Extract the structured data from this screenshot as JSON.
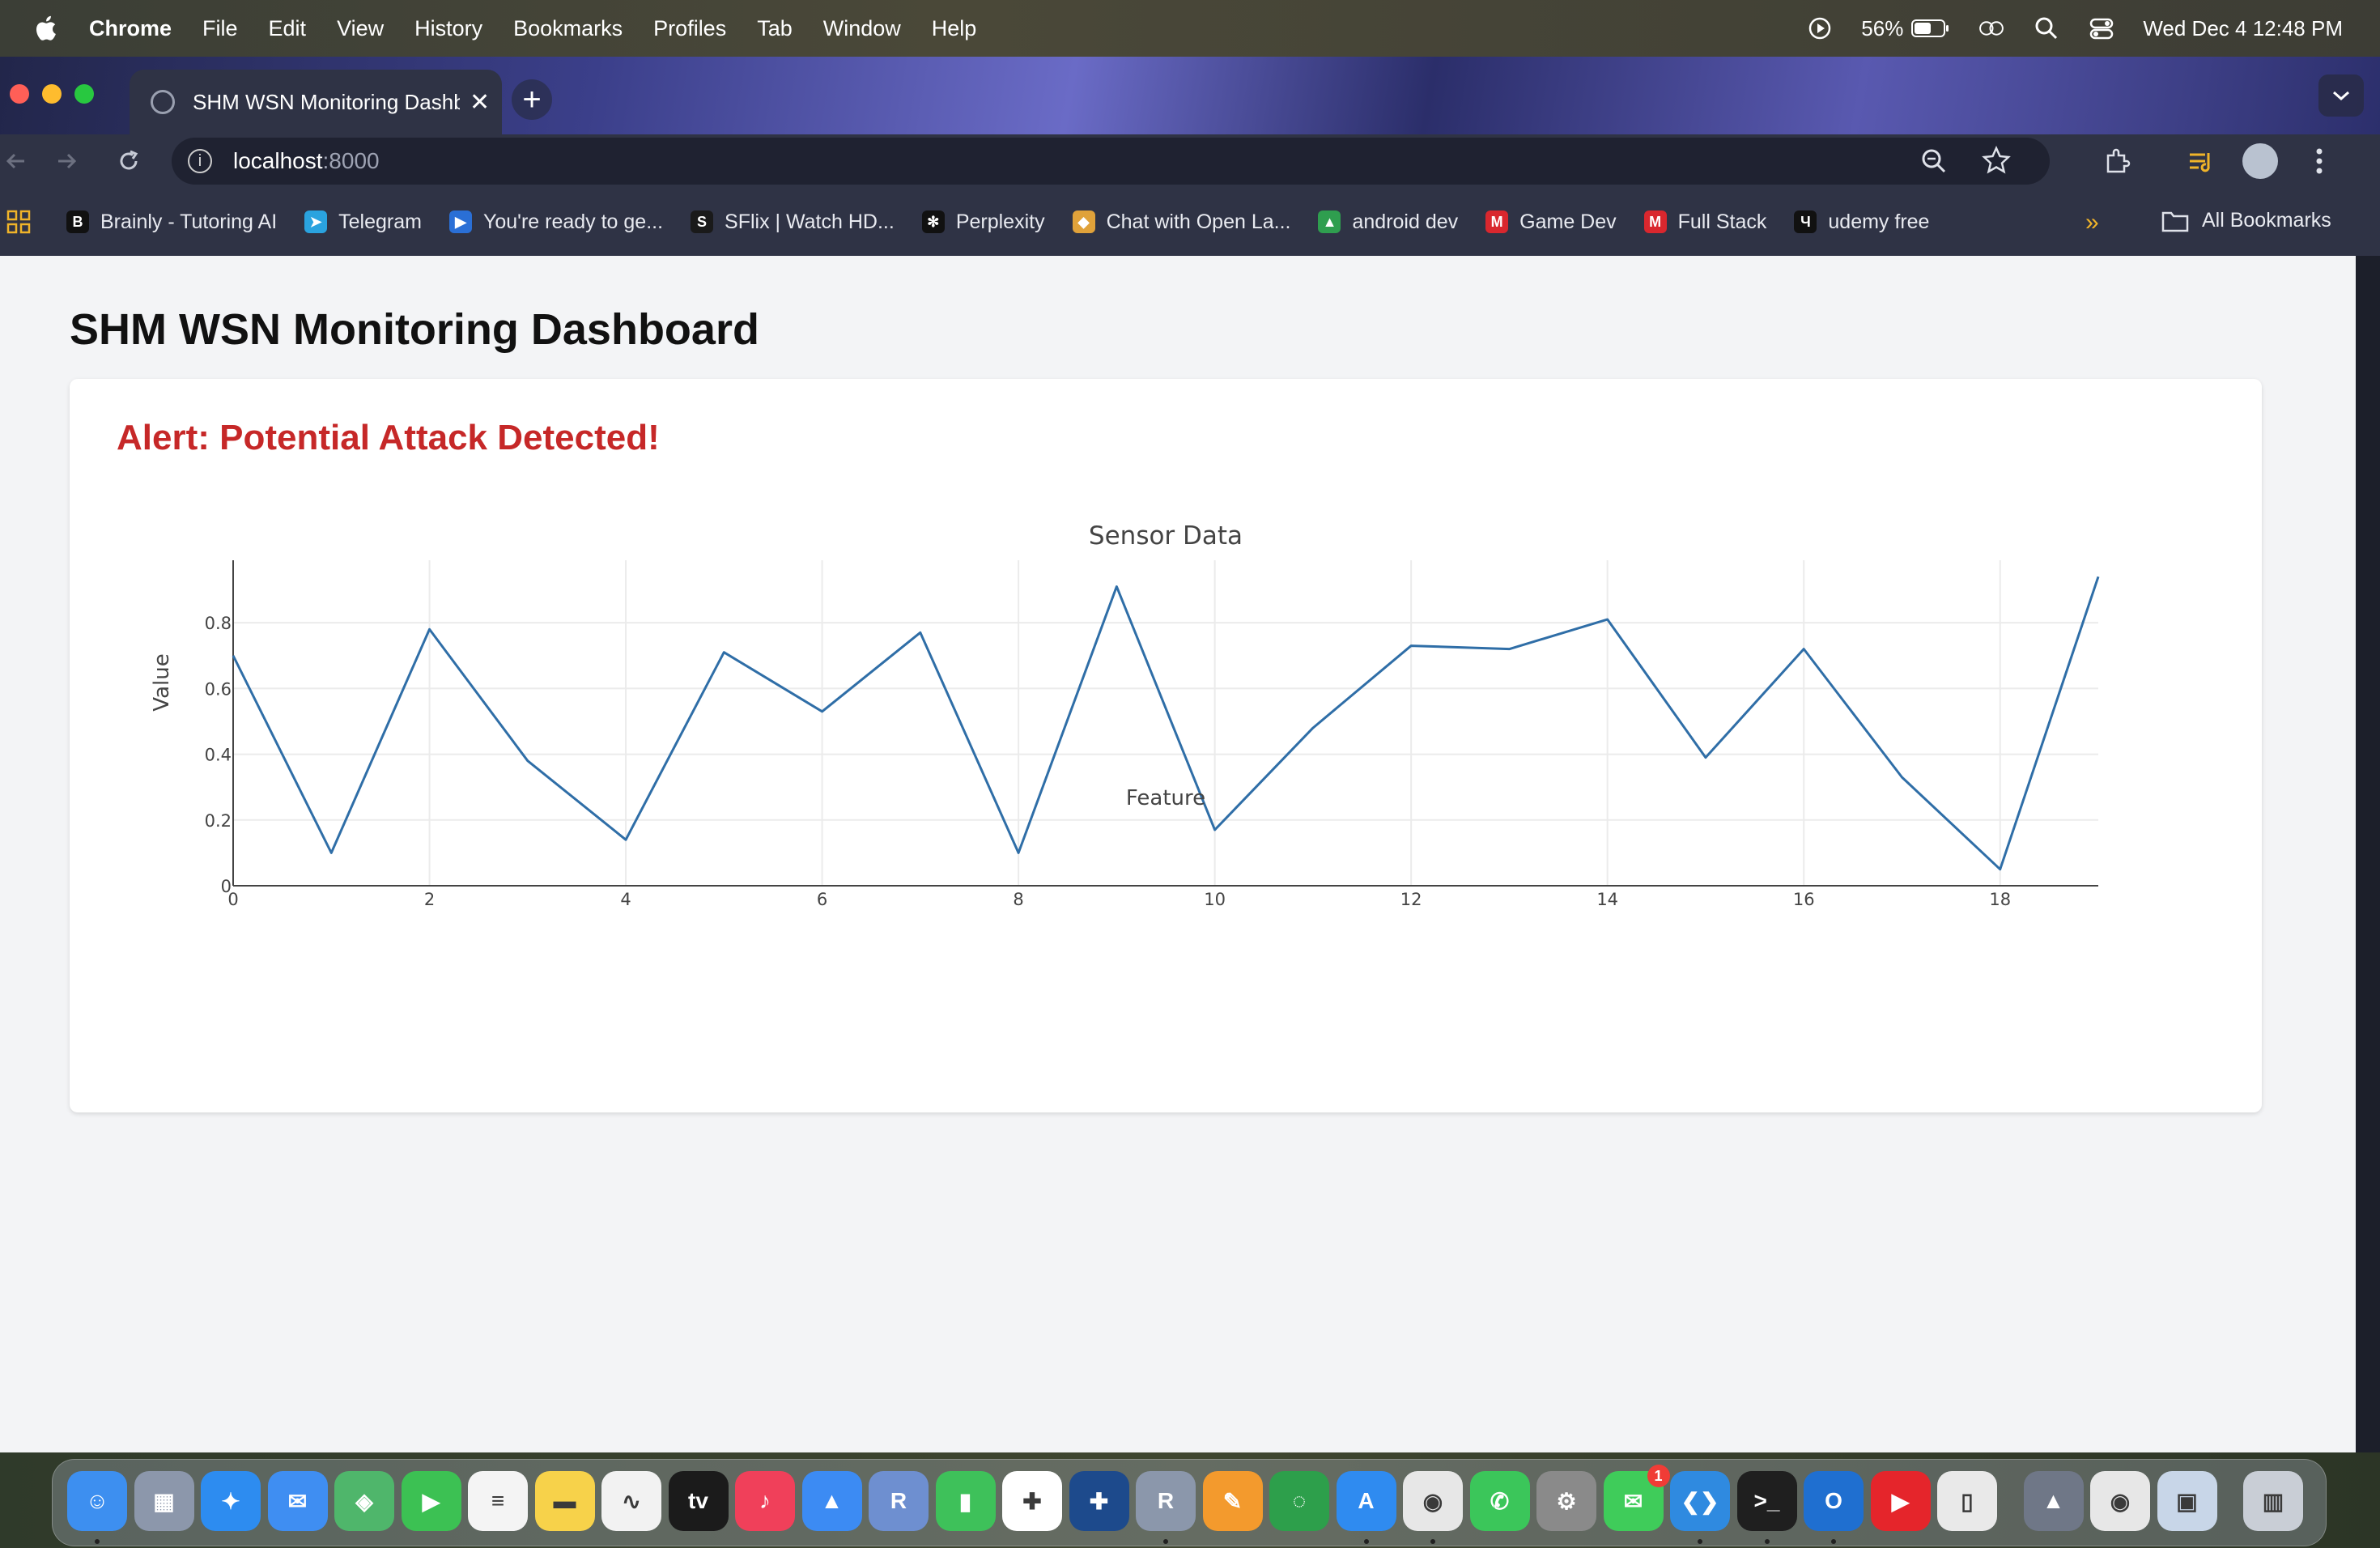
{
  "menubar": {
    "app_name": "Chrome",
    "items": [
      "File",
      "Edit",
      "View",
      "History",
      "Bookmarks",
      "Profiles",
      "Tab",
      "Window",
      "Help"
    ],
    "battery": "56%",
    "datetime": "Wed Dec 4  12:48 PM"
  },
  "browser": {
    "tab_title": "SHM WSN Monitoring Dashboard",
    "url_host": "localhost",
    "url_port": ":8000",
    "bookmarks": [
      {
        "label": "Brainly - Tutoring AI",
        "icon": "brainly-icon",
        "color": "#111111",
        "glyph": "B"
      },
      {
        "label": "Telegram",
        "icon": "telegram-icon",
        "color": "#2aa3df",
        "glyph": "➤"
      },
      {
        "label": "You're ready to ge...",
        "icon": "play-icon",
        "color": "#2a6fd6",
        "glyph": "▶"
      },
      {
        "label": "SFlix | Watch HD...",
        "icon": "sflix-icon",
        "color": "#1a1a1a",
        "glyph": "S"
      },
      {
        "label": "Perplexity",
        "icon": "perplexity-icon",
        "color": "#111111",
        "glyph": "✻"
      },
      {
        "label": "Chat with Open La...",
        "icon": "layers-icon",
        "color": "#e0a23a",
        "glyph": "◆"
      },
      {
        "label": "android dev",
        "icon": "drive-icon",
        "color": "#2f9e4f",
        "glyph": "▲"
      },
      {
        "label": "Game Dev",
        "icon": "mega-icon",
        "color": "#d9272e",
        "glyph": "M"
      },
      {
        "label": "Full Stack",
        "icon": "mega-icon",
        "color": "#d9272e",
        "glyph": "M"
      },
      {
        "label": "udemy free",
        "icon": "udemy-icon",
        "color": "#111111",
        "glyph": "Ч"
      }
    ],
    "all_bookmarks": "All Bookmarks"
  },
  "page": {
    "title": "SHM WSN Monitoring Dashboard",
    "alert": "Alert: Potential Attack Detected!"
  },
  "chart_data": {
    "type": "line",
    "title": "Sensor Data",
    "xlabel": "Feature",
    "ylabel": "Value",
    "x": [
      0,
      1,
      2,
      3,
      4,
      5,
      6,
      7,
      8,
      9,
      10,
      11,
      12,
      13,
      14,
      15,
      16,
      17,
      18,
      19
    ],
    "series": [
      {
        "values": [
          0.7,
          0.1,
          0.78,
          0.38,
          0.14,
          0.71,
          0.53,
          0.77,
          0.1,
          0.91,
          0.17,
          0.48,
          0.73,
          0.72,
          0.81,
          0.39,
          0.72,
          0.33,
          0.05,
          0.94
        ],
        "color": "#2f6ea7"
      }
    ],
    "xticks": [
      0,
      2,
      4,
      6,
      8,
      10,
      12,
      14,
      16,
      18
    ],
    "yticks": [
      0,
      0.2,
      0.4,
      0.6,
      0.8
    ],
    "xlim": [
      0,
      19
    ],
    "ylim": [
      0,
      0.99
    ],
    "grid": true
  },
  "dock": {
    "apps": [
      {
        "name": "finder",
        "color": "#3d8ff0",
        "glyph": "☺"
      },
      {
        "name": "launchpad",
        "color": "#8c97ab",
        "glyph": "▦"
      },
      {
        "name": "safari",
        "color": "#2d8cf0",
        "glyph": "✦"
      },
      {
        "name": "mail",
        "color": "#3f8ef2",
        "glyph": "✉"
      },
      {
        "name": "maps",
        "color": "#4fb66b",
        "glyph": "◈"
      },
      {
        "name": "facetime",
        "color": "#3cc153",
        "glyph": "▶"
      },
      {
        "name": "reminders",
        "color": "#f4f4f4",
        "glyph": "≡"
      },
      {
        "name": "notes",
        "color": "#f7d24a",
        "glyph": "▬"
      },
      {
        "name": "freeform",
        "color": "#f2f2f2",
        "glyph": "∿"
      },
      {
        "name": "apple-tv",
        "color": "#1b1b1b",
        "glyph": "tv"
      },
      {
        "name": "music",
        "color": "#f0405a",
        "glyph": "♪"
      },
      {
        "name": "keynote",
        "color": "#3c8bf3",
        "glyph": "▲"
      },
      {
        "name": "r-studio",
        "color": "#6e8fd0",
        "glyph": "R"
      },
      {
        "name": "numbers",
        "color": "#3ec15a",
        "glyph": "▮"
      },
      {
        "name": "tableau",
        "color": "#ffffff",
        "glyph": "✚"
      },
      {
        "name": "tableau-prep",
        "color": "#1d4a8c",
        "glyph": "✚"
      },
      {
        "name": "r-lang",
        "color": "#8b97ab",
        "glyph": "R"
      },
      {
        "name": "pages",
        "color": "#f39a2d",
        "glyph": "✎"
      },
      {
        "name": "spinner-app",
        "color": "#2d9f4b",
        "glyph": "◌"
      },
      {
        "name": "app-store",
        "color": "#2f8bf0",
        "glyph": "A"
      },
      {
        "name": "chrome",
        "color": "#e7e7e7",
        "glyph": "◉"
      },
      {
        "name": "whatsapp",
        "color": "#3bc65a",
        "glyph": "✆"
      },
      {
        "name": "system-settings",
        "color": "#8a8a8a",
        "glyph": "⚙"
      },
      {
        "name": "messages",
        "color": "#3fcc5a",
        "glyph": "✉"
      },
      {
        "name": "vs-code",
        "color": "#2f8ae0",
        "glyph": "❮❯"
      },
      {
        "name": "terminal",
        "color": "#1f1f1f",
        "glyph": ">_"
      },
      {
        "name": "outlook",
        "color": "#1f6fd0",
        "glyph": "O"
      },
      {
        "name": "youtube",
        "color": "#e5252b",
        "glyph": "▶"
      },
      {
        "name": "simulator",
        "color": "#e9e9e9",
        "glyph": "▯"
      },
      {
        "name": "rocket",
        "color": "#6f7787",
        "glyph": "▲"
      },
      {
        "name": "chrome-2",
        "color": "#e7e7e7",
        "glyph": "◉"
      },
      {
        "name": "preview",
        "color": "#c8d6e8",
        "glyph": "▣"
      },
      {
        "name": "trash",
        "color": "#c9ced6",
        "glyph": "▥"
      }
    ],
    "messages_badge": "1"
  }
}
